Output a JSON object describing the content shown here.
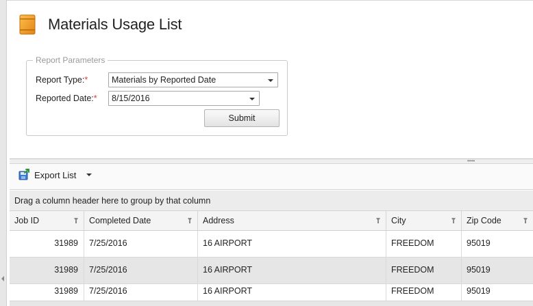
{
  "page": {
    "title": "Materials Usage List"
  },
  "params": {
    "legend": "Report Parameters",
    "report_type_label": "Report Type:",
    "report_type_value": "Materials by Reported Date",
    "reported_date_label": "Reported Date:",
    "reported_date_value": "8/15/2016",
    "required_marker": "*",
    "submit_label": "Submit"
  },
  "toolbar": {
    "export_label": "Export List"
  },
  "grid": {
    "group_hint": "Drag a column header here to group by that column",
    "columns": [
      "Job ID",
      "Completed Date",
      "Address",
      "City",
      "Zip Code"
    ],
    "rows": [
      [
        "31989",
        "7/25/2016",
        "16 AIRPORT",
        "FREEDOM",
        "95019"
      ],
      [
        "31989",
        "7/25/2016",
        "16 AIRPORT",
        "FREEDOM",
        "95019"
      ],
      [
        "31989",
        "7/25/2016",
        "16 AIRPORT",
        "FREEDOM",
        "95019"
      ]
    ]
  },
  "icons": {
    "title": "folder-icon",
    "export": "export-icon",
    "filter": "filter-icon"
  },
  "colors": {
    "title_icon": "#f0a030",
    "required": "#d04040",
    "alt_row": "#e6e6e6"
  }
}
